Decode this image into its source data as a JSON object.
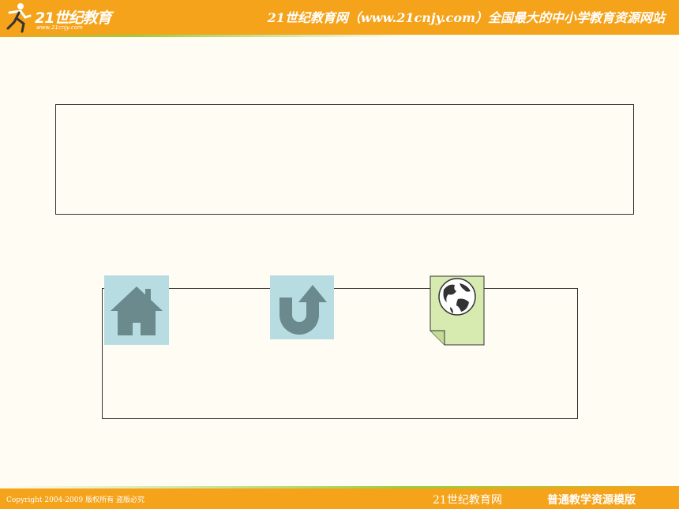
{
  "header": {
    "logo_text": "21世纪教育",
    "logo_url": "www.21cnjy.com",
    "title": "21世纪教育网（www.21cnjy.com）全国最大的中小学教育资源网站"
  },
  "nav": [
    {
      "icon": "home-icon"
    },
    {
      "icon": "return-arrow-icon"
    },
    {
      "icon": "globe-document-icon"
    }
  ],
  "footer": {
    "copyright": "Copyright 2004-2009 版权所有 盗版必究",
    "brand": "21世纪教育网",
    "template": "普通教学资源模版"
  },
  "colors": {
    "bar": "#f5a31a",
    "accent_green": "#9ccc3c",
    "background": "#fefcf3",
    "button_bg": "#b7dde3",
    "icon_gray": "#6b8a8d",
    "doc_green": "#d7eab0"
  }
}
